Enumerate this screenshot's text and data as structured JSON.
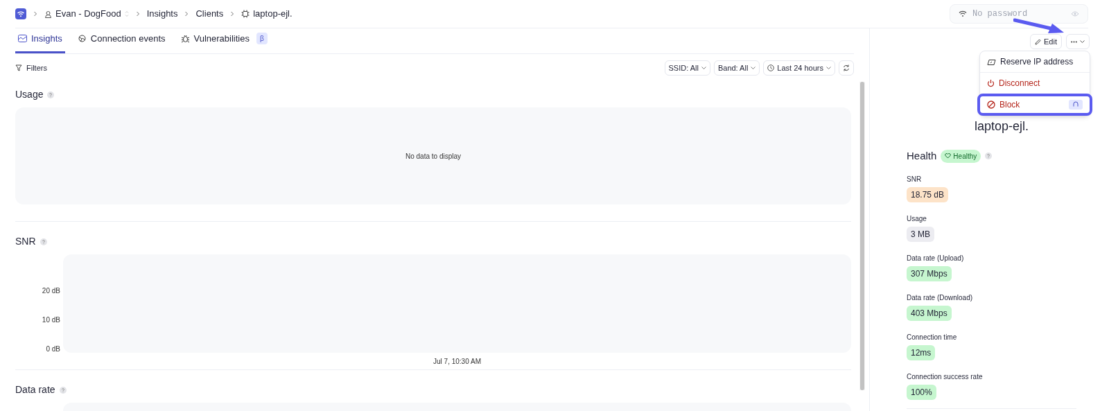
{
  "breadcrumb": [
    {
      "kind": "org",
      "label": "Evan - DogFood"
    },
    {
      "kind": "plain",
      "label": "Insights"
    },
    {
      "kind": "plain",
      "label": "Clients"
    },
    {
      "kind": "device",
      "label": "laptop-ejl."
    }
  ],
  "password_field": {
    "placeholder": "No password"
  },
  "tabs": [
    {
      "label": "Insights",
      "selected": true
    },
    {
      "label": "Connection events",
      "selected": false
    },
    {
      "label": "Vulnerabilities",
      "selected": false,
      "badge": "β"
    }
  ],
  "filters": {
    "label": "Filters",
    "dropdowns": [
      {
        "label": "SSID: All",
        "kind": "plain"
      },
      {
        "label": "Band: All",
        "kind": "plain"
      },
      {
        "label": "Last 24 hours",
        "kind": "time"
      }
    ]
  },
  "sections": [
    {
      "title": "Usage",
      "kind": "empty",
      "message": "No data to display"
    },
    {
      "title": "SNR",
      "kind": "axes",
      "y_labels": [
        "20 dB",
        "10 dB",
        "0 dB"
      ],
      "x_label": "Jul 7, 10:30 AM"
    },
    {
      "title": "Data rate",
      "kind": "axes"
    }
  ],
  "panel": {
    "edit_label": "Edit",
    "menu": [
      {
        "label": "Reserve IP address",
        "kind": "normal",
        "selected": false
      },
      {
        "label": "Disconnect",
        "kind": "danger",
        "selected": false
      },
      {
        "label": "Block",
        "kind": "danger",
        "selected": true
      }
    ],
    "device_name": "laptop-ejl.",
    "health_label": "Health",
    "health_status": "Healthy",
    "metrics": [
      {
        "label": "SNR",
        "value": "18.75 dB",
        "color": "#fde3c8"
      },
      {
        "label": "Usage",
        "value": "3 MB",
        "color": "#ececf1"
      },
      {
        "label": "Data rate (Upload)",
        "value": "307 Mbps",
        "color": "#c6f6cf"
      },
      {
        "label": "Data rate (Download)",
        "value": "403 Mbps",
        "color": "#c6f6cf"
      },
      {
        "label": "Connection time",
        "value": "12ms",
        "color": "#c6f6cf"
      },
      {
        "label": "Connection success rate",
        "value": "100%",
        "color": "#c6f6cf"
      }
    ]
  }
}
